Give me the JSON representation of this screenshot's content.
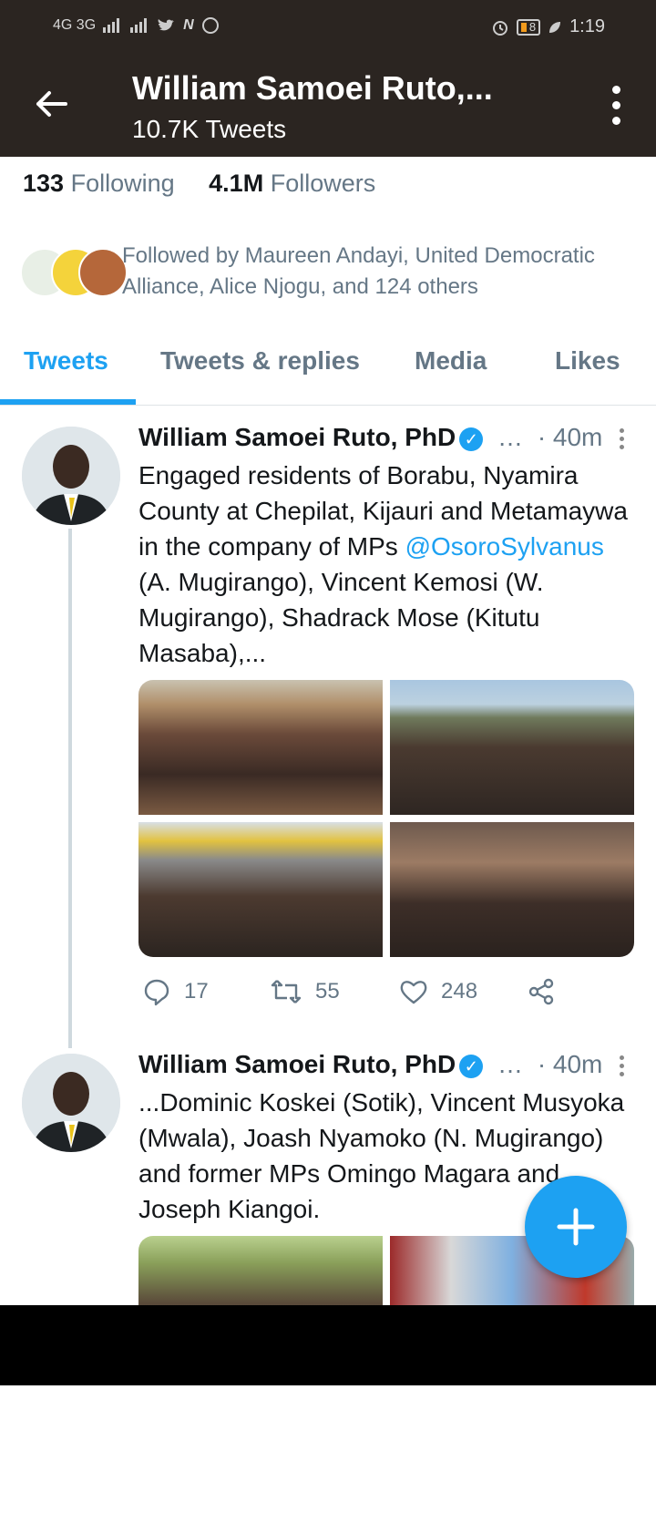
{
  "status_bar": {
    "left_text": "4G 3G",
    "battery": "8",
    "time": "1:19"
  },
  "header": {
    "title": "William Samoei Ruto,...",
    "tweet_count": "10.7K Tweets"
  },
  "profile": {
    "following_count": "133",
    "following_label": "Following",
    "followers_count": "4.1M",
    "followers_label": "Followers",
    "followed_by_text": "Followed by Maureen Andayi, United Democratic Alliance, Alice Njogu, and 124 others"
  },
  "tabs": [
    "Tweets",
    "Tweets & replies",
    "Media",
    "Likes"
  ],
  "tweets": [
    {
      "name": "William Samoei Ruto, PhD",
      "handle_ellipsis": "…",
      "time": "· 40m",
      "text_before": "Engaged residents of Borabu, Nyamira County at Chepilat, Kijauri and Metamaywa in the company of MPs ",
      "mention": "@OsoroSylvanus",
      "text_after": " (A. Mugirango), Vincent Kemosi (W. Mugirango), Shadrack Mose (Kitutu Masaba),...",
      "replies": "17",
      "retweets": "55",
      "likes": "248"
    },
    {
      "name": "William Samoei Ruto, PhD",
      "handle_ellipsis": "…",
      "time": "· 40m",
      "text": "...Dominic Koskei (Sotik), Vincent Musyoka (Mwala), Joash Nyamoko (N. Mugirango) and former MPs Omingo Magara and Joseph Kiangoi."
    }
  ],
  "icons": {
    "back": "back-arrow-icon",
    "more": "more-vertical-icon",
    "verified": "verified-badge-icon",
    "reply": "reply-icon",
    "retweet": "retweet-icon",
    "like": "heart-icon",
    "share": "share-icon",
    "compose": "plus-icon"
  },
  "colors": {
    "accent": "#1da1f2",
    "header_bg": "#2b2521",
    "secondary_text": "#657786"
  }
}
